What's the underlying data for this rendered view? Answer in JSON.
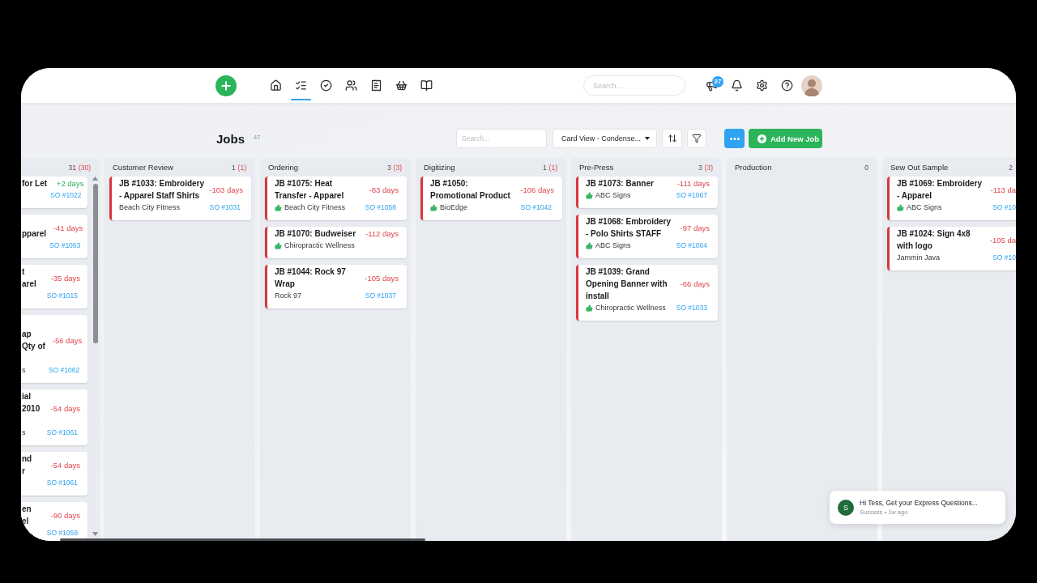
{
  "header": {
    "nav": [
      {
        "kind": "home",
        "selected": false
      },
      {
        "kind": "list",
        "selected": true
      },
      {
        "kind": "check",
        "selected": false
      },
      {
        "kind": "team",
        "selected": false
      },
      {
        "kind": "invoice",
        "selected": false
      },
      {
        "kind": "basket",
        "selected": false
      },
      {
        "kind": "book",
        "selected": false
      }
    ],
    "search": {
      "placeholder": "Search..."
    },
    "badge": "27"
  },
  "toolbar": {
    "title": "Jobs",
    "count": "47",
    "search": {
      "placeholder": "Search..."
    },
    "view": "Card View - Condense...",
    "add_button": "Add New Job"
  },
  "columns": [
    {
      "kind": "leftcut",
      "count": "31",
      "late_count": "(30)",
      "cards": [
        {
          "title_lines": [
            {
              "kind": "text",
              "text": "for Let"
            }
          ],
          "days": "+2 days",
          "overdue": false,
          "order": "SO #1022"
        },
        {
          "title_lines": [
            {
              "kind": "cut"
            },
            {
              "kind": "text",
              "text": "pparel"
            }
          ],
          "days": "-41 days",
          "overdue": true,
          "order": "SO #1063"
        },
        {
          "title_lines": [
            {
              "kind": "text",
              "text": "t"
            },
            {
              "kind": "text",
              "text": "arel"
            }
          ],
          "days": "-35 days",
          "overdue": true,
          "order": "SO #1015"
        },
        {
          "title_lines": [
            {
              "kind": "cut"
            },
            {
              "kind": "text",
              "text": "ap"
            },
            {
              "kind": "text",
              "text": "Qty of"
            },
            {
              "kind": "cut"
            }
          ],
          "days": "-56 days",
          "overdue": true,
          "customer": "s",
          "order": "SO #1062"
        },
        {
          "title_lines": [
            {
              "kind": "text",
              "text": "ial"
            },
            {
              "kind": "text",
              "text": "2010"
            },
            {
              "kind": "cut"
            }
          ],
          "days": "-54 days",
          "overdue": true,
          "customer": "s",
          "order": "SO #1061"
        },
        {
          "title_lines": [
            {
              "kind": "text",
              "text": "nd"
            },
            {
              "kind": "text",
              "text": "r"
            }
          ],
          "days": "-54 days",
          "overdue": true,
          "order": "SO #1061"
        },
        {
          "title_lines": [
            {
              "kind": "text",
              "text": "en"
            },
            {
              "kind": "text",
              "text": "el"
            }
          ],
          "days": "-90 days",
          "overdue": true,
          "order": "SO #1059"
        }
      ]
    },
    {
      "kind": "full",
      "title": "Customer Review",
      "count": "1",
      "late_count": "(1)",
      "cards": [
        {
          "title": "JB #1033: Embroidery - Apparel Staff Shirts",
          "days": "-103 days",
          "overdue": true,
          "customer": "Beach City Fitness",
          "approved": false,
          "order": "SO #1031"
        }
      ]
    },
    {
      "kind": "full",
      "title": "Ordering",
      "count": "3",
      "late_count": "(3)",
      "cards": [
        {
          "title": "JB #1075: Heat Transfer - Apparel",
          "days": "-83 days",
          "overdue": true,
          "customer": "Beach City Fitness",
          "approved": true,
          "order": "SO #1058"
        },
        {
          "title": "JB #1070: Budweiser",
          "days": "-112 days",
          "overdue": true,
          "customer": "Chiropractic Wellness",
          "approved": true
        },
        {
          "title": "JB #1044: Rock 97 Wrap",
          "days": "-105 days",
          "overdue": true,
          "customer": "Rock 97",
          "approved": false,
          "order": "SO #1037"
        }
      ]
    },
    {
      "kind": "full",
      "title": "Digitizing",
      "count": "1",
      "late_count": "(1)",
      "cards": [
        {
          "title": "JB #1050: Promotional Product",
          "days": "-106 days",
          "overdue": true,
          "customer": "BioEdge",
          "approved": true,
          "order": "SO #1042"
        }
      ]
    },
    {
      "kind": "full",
      "title": "Pre-Press",
      "count": "3",
      "late_count": "(3)",
      "cards": [
        {
          "title": "JB #1073: Banner",
          "days": "-111 days",
          "overdue": true,
          "customer": "ABC Signs",
          "approved": true,
          "order": "SO #1067"
        },
        {
          "title": "JB #1068: Embroidery - Polo Shirts STAFF",
          "days": "-97 days",
          "overdue": true,
          "customer": "ABC Signs",
          "approved": true,
          "order": "SO #1064"
        },
        {
          "title": "JB #1039: Grand Opening Banner with install",
          "days": "-66 days",
          "overdue": true,
          "customer": "Chiropractic Wellness",
          "approved": true,
          "order": "SO #1033"
        }
      ]
    },
    {
      "kind": "full",
      "title": "Production",
      "count": "0"
    },
    {
      "kind": "rightcut",
      "title": "Sew Out Sample",
      "count": "2",
      "cards": [
        {
          "title": "JB #1069: Embroidery - Apparel",
          "days": "-113 da",
          "overdue": true,
          "customer": "ABC Signs",
          "approved": true,
          "order": "SO #10"
        },
        {
          "title": "JB #1024: Sign 4x8 with logo",
          "days": "-105 da",
          "overdue": true,
          "customer": "Jammin Java",
          "approved": false,
          "order": "SO #10"
        }
      ]
    }
  ],
  "toast": {
    "initial": "S",
    "message": "Hi Tess, Get your Express Questions...",
    "meta": "Success • 1w ago"
  }
}
